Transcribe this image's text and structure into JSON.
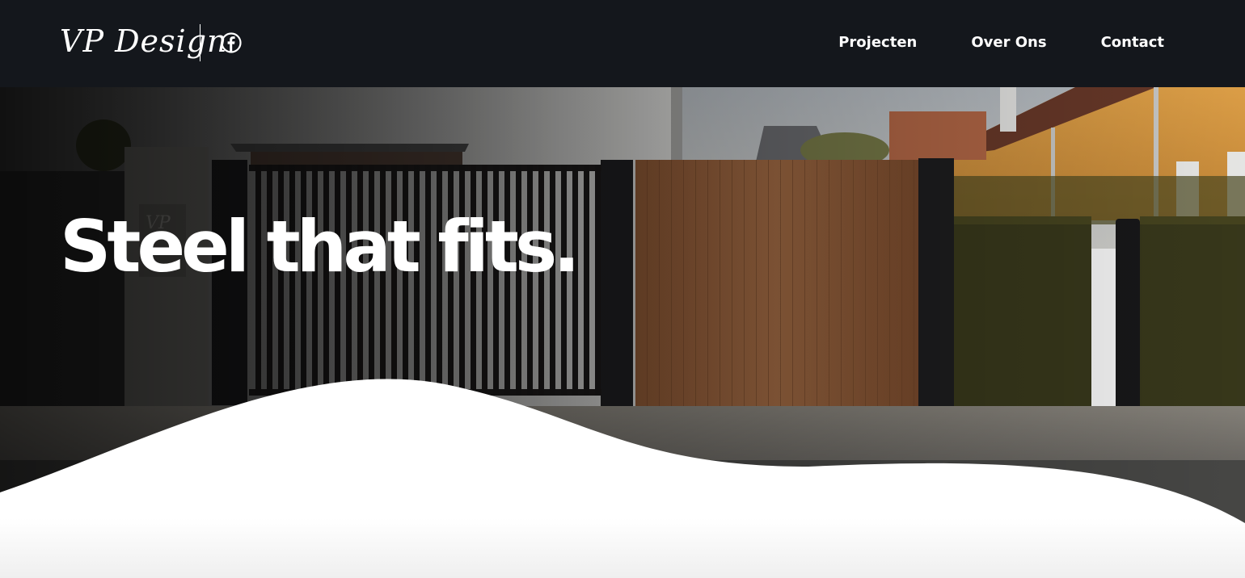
{
  "header": {
    "logo_text": "VP Design",
    "social": {
      "icon": "facebook-icon"
    },
    "nav": [
      {
        "label": "Projecten"
      },
      {
        "label": "Over Ons"
      },
      {
        "label": "Contact"
      }
    ]
  },
  "hero": {
    "headline": "Steel that fits.",
    "pillar_monogram": "VP"
  },
  "colors": {
    "header_bg": "#14171c",
    "text": "#ffffff",
    "wood_gate": "#9a6440",
    "house_wall": "#d89a40",
    "hedge": "#3b3a1a"
  }
}
